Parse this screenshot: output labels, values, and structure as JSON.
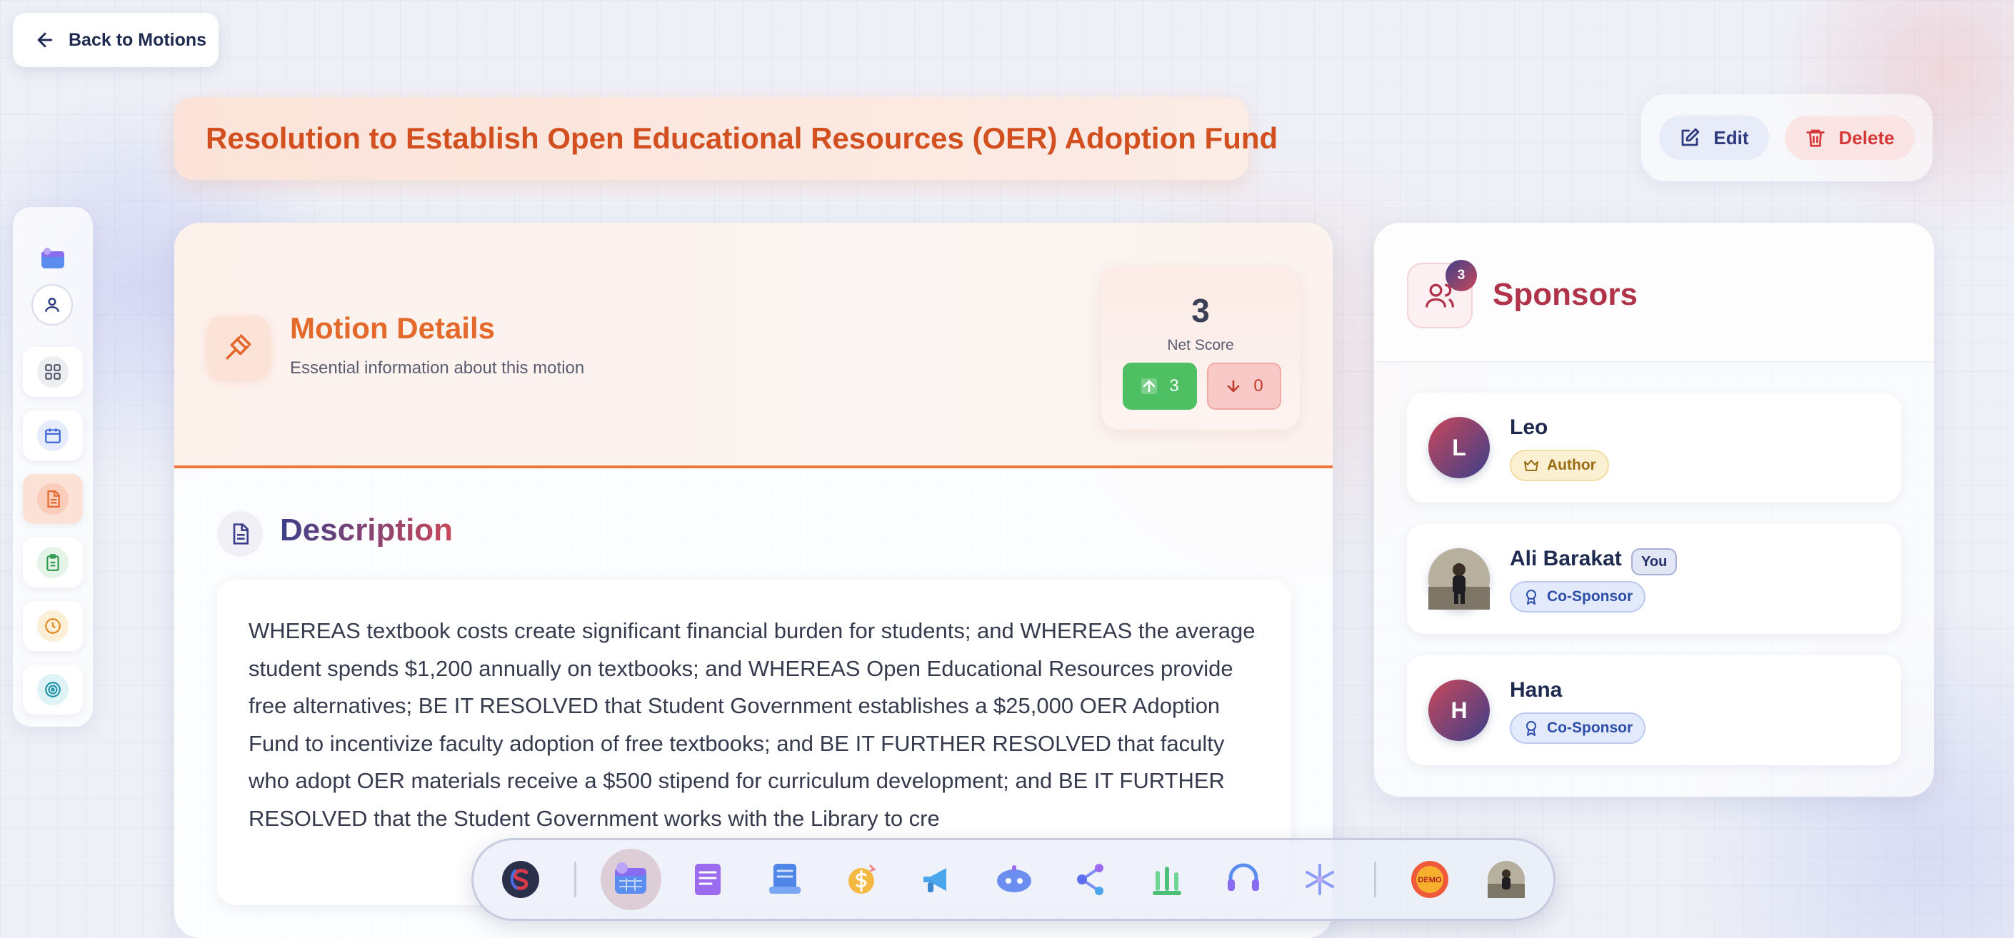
{
  "nav": {
    "back_label": "Back to Motions"
  },
  "motion": {
    "title": "Resolution to Establish Open Educational Resources (OER) Adoption Fund"
  },
  "actions": {
    "edit_label": "Edit",
    "delete_label": "Delete"
  },
  "details": {
    "title": "Motion Details",
    "subtitle": "Essential information about this motion",
    "net_score": "3",
    "net_score_label": "Net Score",
    "upvotes": "3",
    "downvotes": "0"
  },
  "description": {
    "title": "Description",
    "text": "WHEREAS textbook costs create significant financial burden for students; and WHEREAS the average student spends $1,200 annually on textbooks; and WHEREAS Open Educational Resources provide free alternatives; BE IT RESOLVED that Student Government establishes a $25,000 OER Adoption Fund to incentivize faculty adoption of free textbooks; and BE IT FURTHER RESOLVED that faculty who adopt OER materials receive a $500 stipend for curriculum development; and BE IT FURTHER RESOLVED that the Student Government works with the Library to cre"
  },
  "sponsors": {
    "title": "Sponsors",
    "count": "3",
    "list": [
      {
        "initial": "L",
        "name": "Leo",
        "role": "Author"
      },
      {
        "initial": "",
        "name": "Ali Barakat",
        "you": "You",
        "role": "Co-Sponsor"
      },
      {
        "initial": "H",
        "name": "Hana",
        "role": "Co-Sponsor"
      }
    ]
  },
  "sidebar": {
    "icons": [
      "calendar-app-icon",
      "user-icon",
      "dashboard-icon",
      "calendar-icon",
      "document-icon",
      "clipboard-icon",
      "clock-icon",
      "target-icon"
    ],
    "active": "document-icon"
  },
  "dock": {
    "demo_label": "DEMO",
    "colors": {
      "accent": "#e46a2c",
      "brand": "#3d3f8a",
      "danger": "#d53a3a",
      "success": "#4fbf63"
    }
  }
}
